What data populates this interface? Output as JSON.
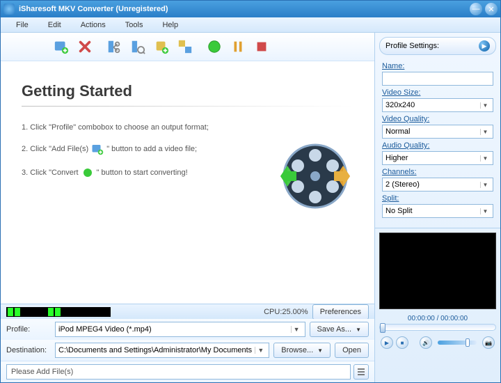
{
  "window": {
    "title": "iSharesoft MKV Converter (Unregistered)"
  },
  "menu": {
    "file": "File",
    "edit": "Edit",
    "actions": "Actions",
    "tools": "Tools",
    "help": "Help"
  },
  "main": {
    "heading": "Getting Started",
    "step1a": "1. Click \"Profile\" combobox to choose an output format;",
    "step2a": "2. Click \"Add File(s)",
    "step2b": "\" button to add a video file;",
    "step3a": "3. Click \"Convert",
    "step3b": "\" button to start converting!"
  },
  "status": {
    "cpu": "CPU:25.00%",
    "preferences": "Preferences"
  },
  "profile": {
    "label": "Profile:",
    "value": "iPod MPEG4 Video (*.mp4)",
    "saveas": "Save As..."
  },
  "destination": {
    "label": "Destination:",
    "value": "C:\\Documents and Settings\\Administrator\\My Documents",
    "browse": "Browse...",
    "open": "Open"
  },
  "message": "Please Add File(s)",
  "panel": {
    "title": "Profile Settings:",
    "name_label": "Name:",
    "name_value": "",
    "videosize_label": "Video Size:",
    "videosize_value": "320x240",
    "videoquality_label": "Video Quality:",
    "videoquality_value": "Normal",
    "audioquality_label": "Audio Quality:",
    "audioquality_value": "Higher",
    "channels_label": "Channels:",
    "channels_value": "2 (Stereo)",
    "split_label": "Split:",
    "split_value": "No Split"
  },
  "player": {
    "time": "00:00:00 / 00:00:00"
  }
}
